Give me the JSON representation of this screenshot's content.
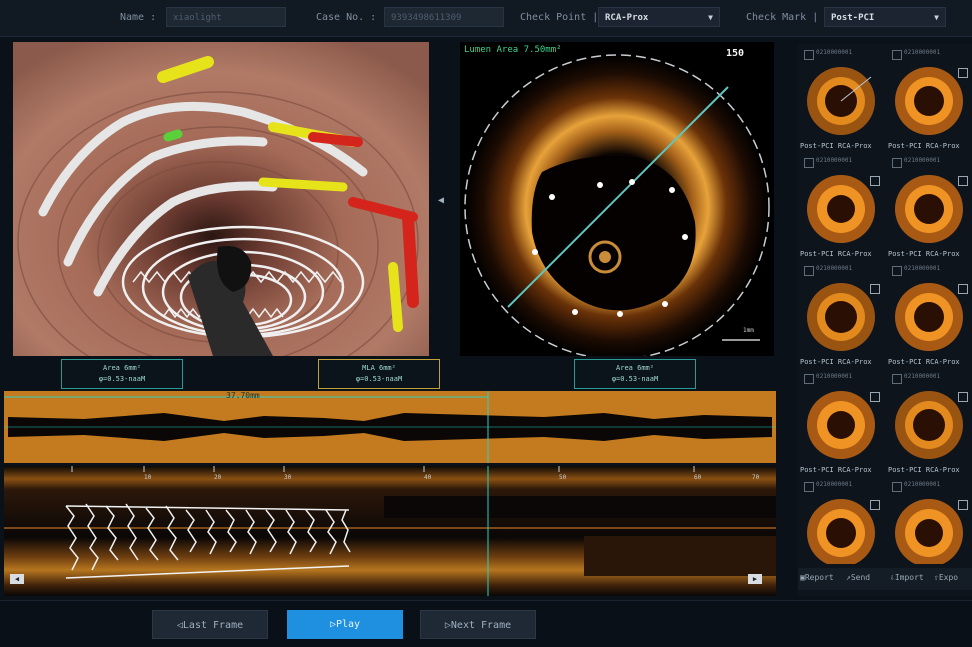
{
  "header": {
    "name_label": "Name :",
    "name_value": "xiaolight",
    "case_label": "Case No. :",
    "case_value": "9393498611309",
    "check_point_label": "Check Point |",
    "check_point_value": "RCA-Prox",
    "check_mark_label": "Check Mark |",
    "check_mark_value": "Post-PCI"
  },
  "oct_view": {
    "lumen_area": "Lumen Area  7.50mm²",
    "frame": "150"
  },
  "measures": [
    {
      "line1": "Area 6mm²",
      "line2": "φ=0.53-naaM"
    },
    {
      "line1": "MLA 6mm²",
      "line2": "φ=0.53-naaM"
    },
    {
      "line1": "Area 6mm²",
      "line2": "φ=0.53-naaM"
    }
  ],
  "long_view": {
    "marker_label": "37.70mm",
    "ticks": [
      "10",
      "20",
      "30",
      "40",
      "50",
      "60",
      "70"
    ]
  },
  "thumbnails": [
    {
      "id": "0210000001",
      "caption": "Post-PCI  RCA-Prox"
    },
    {
      "id": "0210000001",
      "caption": "Post-PCI  RCA-Prox"
    },
    {
      "id": "0210000001",
      "caption": "Post-PCI  RCA-Prox"
    },
    {
      "id": "0210000001",
      "caption": "Post-PCI  RCA-Prox"
    },
    {
      "id": "0210000001",
      "caption": "Post-PCI  RCA-Prox"
    },
    {
      "id": "0210000001",
      "caption": "Post-PCI  RCA-Prox"
    },
    {
      "id": "0210000001",
      "caption": "Post-PCI  RCA-Prox"
    },
    {
      "id": "0210000001",
      "caption": "Post-PCI  RCA-Prox"
    },
    {
      "id": "0210000001",
      "caption": ""
    },
    {
      "id": "0210000001",
      "caption": ""
    }
  ],
  "export_bar": {
    "report": "Report",
    "send": "Send",
    "import": "Import",
    "export": "Expo"
  },
  "controls": {
    "last_frame": "Last Frame",
    "play": "Play",
    "next_frame": "Next Frame"
  },
  "colors": {
    "accent": "#1f8fe0",
    "teal": "#2a9a95",
    "stent_yellow": "#e7e31b",
    "stent_red": "#d4241b"
  }
}
